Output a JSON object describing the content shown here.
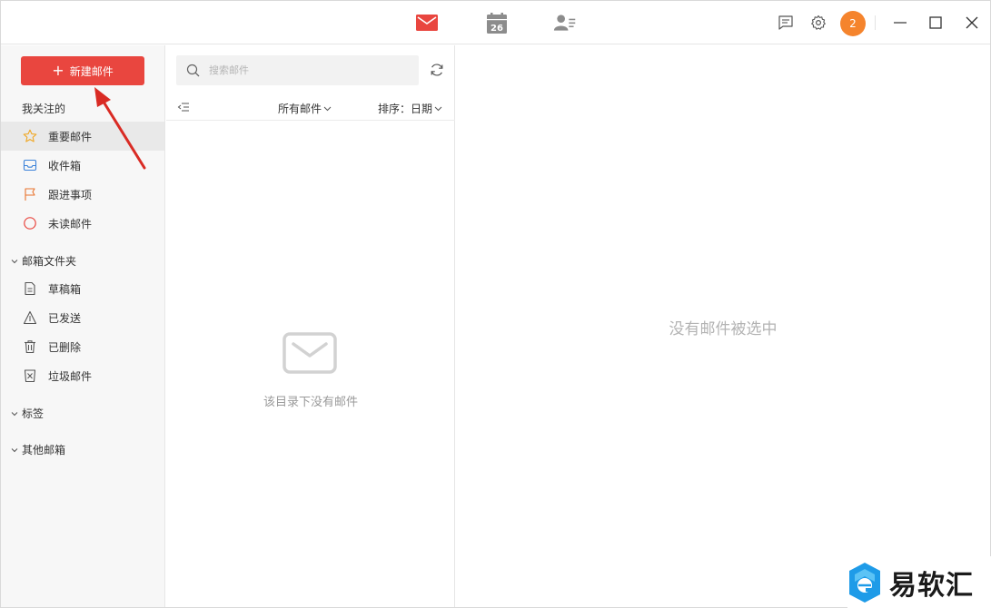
{
  "titlebar": {
    "nav": [
      {
        "name": "mail",
        "color": "#e9463f"
      },
      {
        "name": "calendar",
        "day": "26",
        "color": "#8c8c8c"
      },
      {
        "name": "contacts",
        "color": "#8c8c8c"
      }
    ],
    "avatar_count": "2",
    "avatar_color": "#f5842d"
  },
  "sidebar": {
    "compose_label": "新建邮件",
    "compose_color": "#e9463f",
    "favorites_title": "我关注的",
    "favorites": [
      {
        "label": "重要邮件",
        "icon": "star-icon",
        "active": true
      },
      {
        "label": "收件箱",
        "icon": "inbox-icon"
      },
      {
        "label": "跟进事项",
        "icon": "flag-icon"
      },
      {
        "label": "未读邮件",
        "icon": "unread-circle-icon"
      }
    ],
    "folders_title": "邮箱文件夹",
    "folders": [
      {
        "label": "草稿箱",
        "icon": "draft-icon"
      },
      {
        "label": "已发送",
        "icon": "sent-icon"
      },
      {
        "label": "已删除",
        "icon": "trash-icon"
      },
      {
        "label": "垃圾邮件",
        "icon": "spam-icon"
      }
    ],
    "tags_title": "标签",
    "other_title": "其他邮箱"
  },
  "list": {
    "search_placeholder": "搜索邮件",
    "filter_label": "所有邮件",
    "sort_label": "排序：日期",
    "empty_text": "该目录下没有邮件"
  },
  "detail": {
    "empty_text": "没有邮件被选中"
  },
  "watermark": {
    "text": "易软汇"
  }
}
